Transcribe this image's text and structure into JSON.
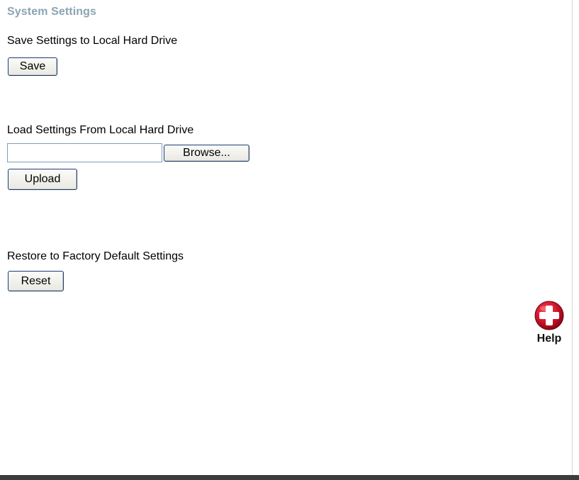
{
  "page": {
    "title": "System Settings"
  },
  "save_section": {
    "label": "Save Settings to Local Hard Drive",
    "button_label": "Save"
  },
  "load_section": {
    "label": "Load Settings From Local Hard Drive",
    "file_value": "",
    "browse_label": "Browse...",
    "upload_label": "Upload"
  },
  "reset_section": {
    "label": "Restore to Factory Default Settings",
    "button_label": "Reset"
  },
  "help": {
    "label": "Help",
    "icon": "help-plus-icon",
    "icon_color": "#d0122b"
  },
  "colors": {
    "title": "#8aa4b3",
    "button_border": "#1c3d73",
    "input_border": "#7f9db9",
    "bottom_bar": "#3c3c3c"
  }
}
